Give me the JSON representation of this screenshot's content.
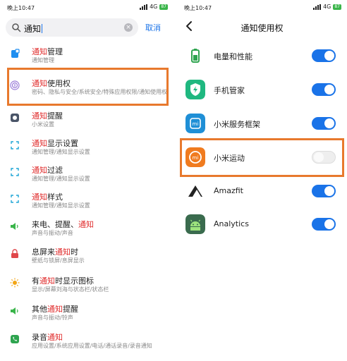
{
  "left": {
    "status": {
      "time": "晚上10:47",
      "network": "4G",
      "battery": "87"
    },
    "search": {
      "query": "通知",
      "cancel_label": "取消"
    },
    "results": [
      {
        "title_before": "",
        "title_hl": "通知",
        "title_after": "管理",
        "subtitle": "通知管理",
        "icon": "note-icon",
        "color": "#1e8ef0"
      },
      {
        "title_before": "",
        "title_hl": "通知",
        "title_after": "使用权",
        "subtitle": "密码、隐私与安全/系统安全/特殊应用权限/通知使用权",
        "icon": "fingerprint-icon",
        "color": "#9b7cd8"
      },
      {
        "title_before": "",
        "title_hl": "通知",
        "title_after": "提醒",
        "subtitle": "小米设置",
        "icon": "circle-app-icon",
        "color": "#4a5568"
      },
      {
        "title_before": "",
        "title_hl": "通知",
        "title_after": "显示设置",
        "subtitle": "通知管理/通知显示设置",
        "icon": "corner-bracket-icon",
        "color": "#1ea5d6"
      },
      {
        "title_before": "",
        "title_hl": "通知",
        "title_after": "过滤",
        "subtitle": "通知管理/通知显示设置",
        "icon": "corner-bracket-icon",
        "color": "#1ea5d6"
      },
      {
        "title_before": "",
        "title_hl": "通知",
        "title_after": "样式",
        "subtitle": "通知管理/通知显示设置",
        "icon": "corner-bracket-icon",
        "color": "#1ea5d6"
      },
      {
        "title_before": "来电、提醒、",
        "title_hl": "通知",
        "title_after": "",
        "subtitle": "声音与振动/声音",
        "icon": "speaker-icon",
        "color": "#3ab54a"
      },
      {
        "title_before": "息屏来",
        "title_hl": "通知",
        "title_after": "时",
        "subtitle": "壁纸与锁屏/息屏显示",
        "icon": "lock-icon",
        "color": "#e0464a"
      },
      {
        "title_before": "有",
        "title_hl": "通知",
        "title_after": "时显示图标",
        "subtitle": "显示/屏幕刘海与状态栏/状态栏",
        "icon": "sun-icon",
        "color": "#f2a516"
      },
      {
        "title_before": "其他",
        "title_hl": "通知",
        "title_after": "提醒",
        "subtitle": "声音与振动/铃声",
        "icon": "speaker-icon",
        "color": "#3ab54a"
      },
      {
        "title_before": "录音",
        "title_hl": "通知",
        "title_after": "",
        "subtitle": "应用设置/系统应用设置/电话/通话录音/录音通知",
        "icon": "phone-icon",
        "color": "#2ea44f"
      }
    ]
  },
  "right": {
    "status": {
      "time": "晚上10:47",
      "network": "4G",
      "battery": "87"
    },
    "title": "通知使用权",
    "apps": [
      {
        "name": "电量和性能",
        "icon": "battery-icon",
        "enabled": true
      },
      {
        "name": "手机管家",
        "icon": "shield-icon",
        "enabled": true
      },
      {
        "name": "小米服务框架",
        "icon": "mi-service-icon",
        "enabled": true
      },
      {
        "name": "小米运动",
        "icon": "mi-fit-icon",
        "enabled": false
      },
      {
        "name": "Amazfit",
        "icon": "amazfit-icon",
        "enabled": true
      },
      {
        "name": "Analytics",
        "icon": "android-icon",
        "enabled": true
      }
    ]
  }
}
